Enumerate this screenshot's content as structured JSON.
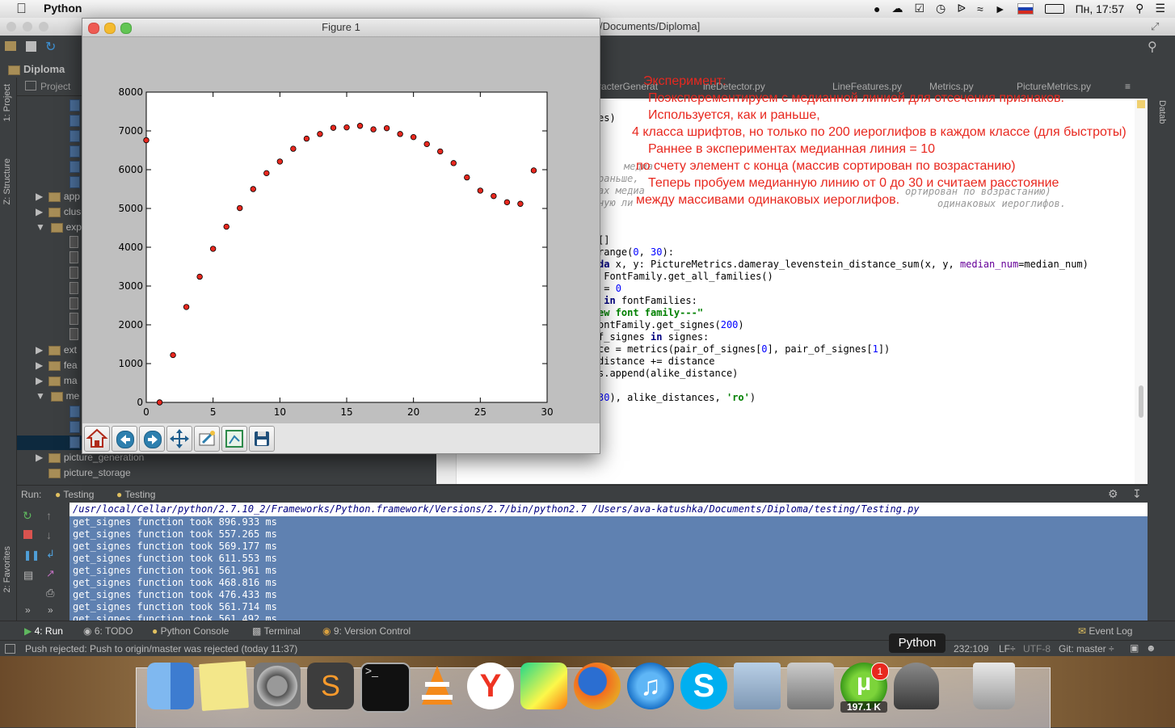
{
  "menubar": {
    "app_name": "Python",
    "status": {
      "clock": "Пн, 17:57",
      "icons": [
        "creative-cloud-icon",
        "cloud-icon",
        "todo-icon",
        "time-machine-icon",
        "bluetooth-icon",
        "wifi-icon",
        "volume-icon",
        "russian-flag-icon",
        "battery-icon",
        "spotlight-icon",
        "notification-icon"
      ]
    }
  },
  "ide": {
    "window_title": "/Documents/Diploma]",
    "nav_project": "Diploma",
    "project_header": "Project",
    "left_tabs": {
      "project": "1: Project",
      "structure": "Z: Structure",
      "favorites": "2: Favorites"
    },
    "right_tab": "Datab"
  },
  "tree": [
    {
      "label": "app",
      "kind": "folder",
      "expanded": false
    },
    {
      "label": "clus",
      "kind": "folder",
      "expanded": false
    },
    {
      "label": "exp",
      "kind": "folder",
      "expanded": true
    },
    {
      "label": "ext",
      "kind": "folder",
      "expanded": false
    },
    {
      "label": "fea",
      "kind": "folder",
      "expanded": false
    },
    {
      "label": "ma",
      "kind": "folder",
      "expanded": false
    },
    {
      "label": "me",
      "kind": "folder",
      "expanded": true
    },
    {
      "label": "picture_generation",
      "kind": "folder",
      "expanded": false
    },
    {
      "label": "picture_storage",
      "kind": "folder",
      "expanded": false
    }
  ],
  "editor_tabs": [
    "racterGenerat",
    "ineDetector.py",
    "LineFeatures.py",
    "Metrics.py",
    "PictureMetrics.py"
  ],
  "code": {
    "frag_es": "es)",
    "comment_fragments": [
      "медиа",
      "раньше,",
      "ах медиа",
      "ную ли",
      "ортирован по возрастанию)",
      "одинаковых иероглифов."
    ],
    "l1": "[]",
    "l2_a": "range(",
    "l2_n1": "0",
    "l2_b": ", ",
    "l2_n2": "30",
    "l2_c": "):",
    "l3_kw": "da",
    "l3_a": " x, y: PictureMetrics.dameray_levenstein_distance_sum(x, y, ",
    "l3_param": "median_num",
    "l3_b": "=median_num)",
    "l4": " FontFamily.get_all_families()",
    "l5_a": " = ",
    "l5_n": "0",
    "l6_kw": " in",
    "l6_b": " fontFamilies:",
    "l7_str": "ew font family---\"",
    "l8_a": "ontFamily.get_signes(",
    "l8_n": "200",
    "l8_b": ")",
    "l9_a": "f_signes ",
    "l9_kw": "in",
    "l9_b": " signes:",
    "l10_a": "ce = metrics(pair_of_signes[",
    "l10_n1": "0",
    "l10_b": "], pair_of_signes[",
    "l10_n2": "1",
    "l10_c": "])",
    "l11": "distance += distance",
    "l12": "s.append(alike_distance)",
    "l13_n": "30",
    "l13_a": "), alike_distances, ",
    "l13_str": "'ro'",
    "l13_b": ")"
  },
  "annotation": {
    "colors": {
      "text": "#e8281f"
    },
    "lines": [
      "Эксперимент:",
      "Поэксперементируем с медианной линией для отсечения признаков.",
      "Используется, как и раньше,",
      "4 класса шрифтов, но только по 200 иероглифов в каждом классе (для быстроты)",
      "Раннее в экспериментах медианная линия = 10",
      "по счету элемент с конца (массив сортирован по возрастанию)",
      "Теперь пробуем медианную линию от 0 до 30 и считаем расстояние",
      "между  массивами одинаковых иероглифов."
    ]
  },
  "run": {
    "label": "Run:",
    "tabs": [
      "Testing",
      "Testing"
    ],
    "command": "/usr/local/Cellar/python/2.7.10_2/Frameworks/Python.framework/Versions/2.7/bin/python2.7 /Users/ava-katushka/Documents/Diploma/testing/Testing.py",
    "output": [
      "get_signes function took 896.933 ms",
      "get_signes function took 557.265 ms",
      "get_signes function took 569.177 ms",
      "get_signes function took 611.553 ms",
      "get_signes function took 561.961 ms",
      "get_signes function took 468.816 ms",
      "get_signes function took 476.433 ms",
      "get_signes function took 561.714 ms",
      "get_signes function took 561.492 ms"
    ]
  },
  "toolwindows": {
    "run": "4: Run",
    "todo": "6: TODO",
    "console": "Python Console",
    "terminal": "Terminal",
    "vcs": "9: Version Control",
    "event_log": "Event Log"
  },
  "status": {
    "message": "Push rejected: Push to origin/master was rejected (today 11:37)",
    "position": "232:109",
    "line_sep": "LF÷",
    "encoding": "UTF-8",
    "vcs": "Git: master ÷",
    "tooltip": "Python"
  },
  "dock": {
    "apps": [
      "finder",
      "stickies",
      "system-preferences",
      "sublime-text",
      "terminal",
      "vlc",
      "yandex-browser",
      "pycharm",
      "firefox",
      "itunes",
      "skype",
      "mail",
      "image-capture",
      "utorrent",
      "python-launcher",
      "trash"
    ],
    "utorrent_badge": "1",
    "utorrent_label": "197.1 K"
  },
  "figure": {
    "window_title": "Figure 1",
    "toolbar": [
      "home",
      "back",
      "forward",
      "pan",
      "zoom",
      "configure-subplots",
      "save"
    ]
  },
  "chart_data": {
    "type": "scatter",
    "title": "",
    "xlabel": "",
    "ylabel": "",
    "xlim": [
      0,
      30
    ],
    "ylim": [
      0,
      8000
    ],
    "xticks": [
      0,
      5,
      10,
      15,
      20,
      25,
      30
    ],
    "yticks": [
      0,
      1000,
      2000,
      3000,
      4000,
      5000,
      6000,
      7000,
      8000
    ],
    "marker_color": "#e8281f",
    "series": [
      {
        "x": [
          0,
          1,
          2,
          3,
          4,
          5,
          6,
          7,
          8,
          9,
          10,
          11,
          12,
          13,
          14,
          15,
          16,
          17,
          18,
          19,
          20,
          21,
          22,
          23,
          24,
          25,
          26,
          27,
          28,
          29
        ],
        "y": [
          6760,
          0,
          1220,
          2460,
          3240,
          3960,
          4530,
          5010,
          5500,
          5910,
          6210,
          6540,
          6800,
          6920,
          7080,
          7090,
          7130,
          7040,
          7070,
          6920,
          6840,
          6660,
          6470,
          6170,
          5800,
          5460,
          5320,
          5160,
          5120,
          5980
        ]
      }
    ]
  }
}
